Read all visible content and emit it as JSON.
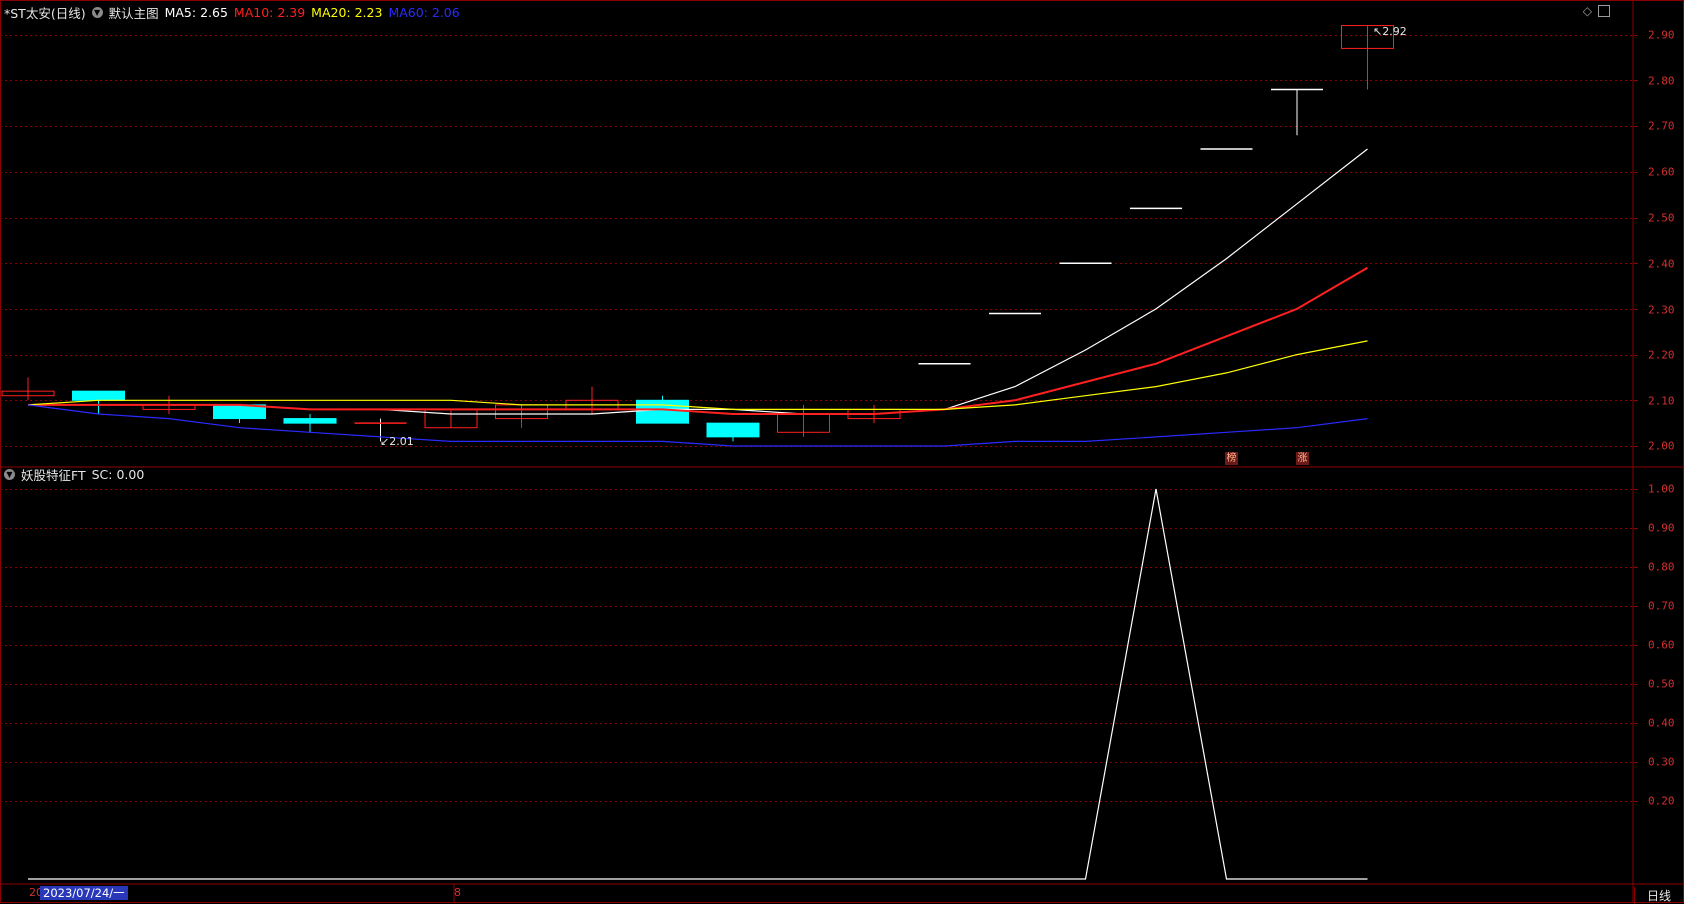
{
  "header": {
    "title": "*ST太安(日线)",
    "template": "默认主图",
    "ma": [
      {
        "label": "MA5: 2.65",
        "color": "#ffffff"
      },
      {
        "label": "MA10: 2.39",
        "color": "#ff2020"
      },
      {
        "label": "MA20: 2.23",
        "color": "#ffff00"
      },
      {
        "label": "MA60: 2.06",
        "color": "#2a2aff"
      }
    ]
  },
  "indicator": {
    "title": "妖股特征FT",
    "value_label": "SC: 0.00"
  },
  "price_axis": [
    "2.90",
    "2.80",
    "2.70",
    "2.60",
    "2.50",
    "2.40",
    "2.30",
    "2.20",
    "2.10",
    "2.00"
  ],
  "ind_axis": [
    "1.00",
    "0.90",
    "0.80",
    "0.70",
    "0.60",
    "0.50",
    "0.40",
    "0.30",
    "0.20"
  ],
  "annotations": {
    "high": "2.92",
    "low": "2.01"
  },
  "tags": [
    "榜",
    "涨"
  ],
  "footer": {
    "left_mark": "20",
    "date": "2023/07/24/一",
    "mid_mark": "8",
    "period": "日线"
  },
  "colors": {
    "up": "#ff2020",
    "down": "#00ffff",
    "grid": "#8b0000",
    "axis_text": "#d23030"
  },
  "chart_data": {
    "type": "candlestick",
    "candles": [
      {
        "open": 2.11,
        "close": 2.12,
        "high": 2.15,
        "low": 2.1
      },
      {
        "open": 2.12,
        "close": 2.1,
        "high": 2.12,
        "low": 2.07
      },
      {
        "open": 2.08,
        "close": 2.09,
        "high": 2.11,
        "low": 2.07
      },
      {
        "open": 2.09,
        "close": 2.06,
        "high": 2.09,
        "low": 2.05
      },
      {
        "open": 2.06,
        "close": 2.05,
        "high": 2.07,
        "low": 2.03
      },
      {
        "open": 2.05,
        "close": 2.05,
        "high": 2.06,
        "low": 2.01
      },
      {
        "open": 2.04,
        "close": 2.08,
        "high": 2.08,
        "low": 2.04
      },
      {
        "open": 2.06,
        "close": 2.09,
        "high": 2.09,
        "low": 2.04
      },
      {
        "open": 2.08,
        "close": 2.1,
        "high": 2.13,
        "low": 2.07
      },
      {
        "open": 2.1,
        "close": 2.05,
        "high": 2.11,
        "low": 2.05
      },
      {
        "open": 2.05,
        "close": 2.02,
        "high": 2.05,
        "low": 2.01
      },
      {
        "open": 2.03,
        "close": 2.07,
        "high": 2.09,
        "low": 2.02
      },
      {
        "open": 2.06,
        "close": 2.08,
        "high": 2.09,
        "low": 2.05
      },
      {
        "open": 2.18,
        "close": 2.18,
        "high": 2.18,
        "low": 2.18
      },
      {
        "open": 2.29,
        "close": 2.29,
        "high": 2.29,
        "low": 2.29
      },
      {
        "open": 2.4,
        "close": 2.4,
        "high": 2.4,
        "low": 2.4
      },
      {
        "open": 2.52,
        "close": 2.52,
        "high": 2.52,
        "low": 2.52
      },
      {
        "open": 2.65,
        "close": 2.65,
        "high": 2.65,
        "low": 2.65
      },
      {
        "open": 2.78,
        "close": 2.78,
        "high": 2.78,
        "low": 2.68
      },
      {
        "open": 2.87,
        "close": 2.92,
        "high": 2.92,
        "low": 2.78
      }
    ],
    "series": [
      {
        "name": "MA5",
        "color": "#ffffff",
        "values": [
          2.09,
          2.09,
          2.09,
          2.09,
          2.08,
          2.08,
          2.07,
          2.07,
          2.07,
          2.08,
          2.08,
          2.07,
          2.07,
          2.08,
          2.13,
          2.21,
          2.3,
          2.41,
          2.53,
          2.65
        ]
      },
      {
        "name": "MA10",
        "color": "#ff2020",
        "values": [
          2.09,
          2.09,
          2.09,
          2.09,
          2.08,
          2.08,
          2.08,
          2.08,
          2.08,
          2.08,
          2.07,
          2.07,
          2.07,
          2.08,
          2.1,
          2.14,
          2.18,
          2.24,
          2.3,
          2.39
        ]
      },
      {
        "name": "MA20",
        "color": "#ffff00",
        "values": [
          2.09,
          2.1,
          2.1,
          2.1,
          2.1,
          2.1,
          2.1,
          2.09,
          2.09,
          2.09,
          2.08,
          2.08,
          2.08,
          2.08,
          2.09,
          2.11,
          2.13,
          2.16,
          2.2,
          2.23
        ]
      },
      {
        "name": "MA60",
        "color": "#2a2aff",
        "values": [
          2.09,
          2.07,
          2.06,
          2.04,
          2.03,
          2.02,
          2.01,
          2.01,
          2.01,
          2.01,
          2.0,
          2.0,
          2.0,
          2.0,
          2.01,
          2.01,
          2.02,
          2.03,
          2.04,
          2.06
        ]
      }
    ],
    "indicator": {
      "name": "SC",
      "values": [
        0,
        0,
        0,
        0,
        0,
        0,
        0,
        0,
        0,
        0,
        0,
        0,
        0,
        0,
        0,
        0,
        1,
        0,
        0,
        0
      ],
      "ylim": [
        0,
        1.0
      ]
    },
    "ylim": [
      1.97,
      2.96
    ]
  }
}
